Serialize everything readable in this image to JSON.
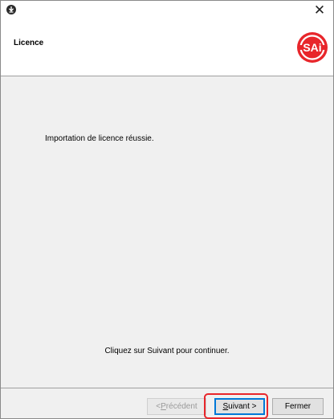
{
  "window": {
    "close_glyph": "✕"
  },
  "header": {
    "title": "Licence",
    "logo_text": "SAi",
    "logo_color": "#e8262b"
  },
  "content": {
    "message": "Importation de licence réussie.",
    "instruction": "Cliquez sur Suivant pour continuer."
  },
  "footer": {
    "prev": {
      "mnemonic": "P",
      "rest": "récédent",
      "prefix": "< ",
      "enabled": false
    },
    "next": {
      "mnemonic": "S",
      "rest": "uivant >"
    },
    "close_label": "Fermer"
  },
  "colors": {
    "highlight": "#e8262b",
    "focus_border": "#0078d7",
    "panel_bg": "#f0f0f0"
  }
}
